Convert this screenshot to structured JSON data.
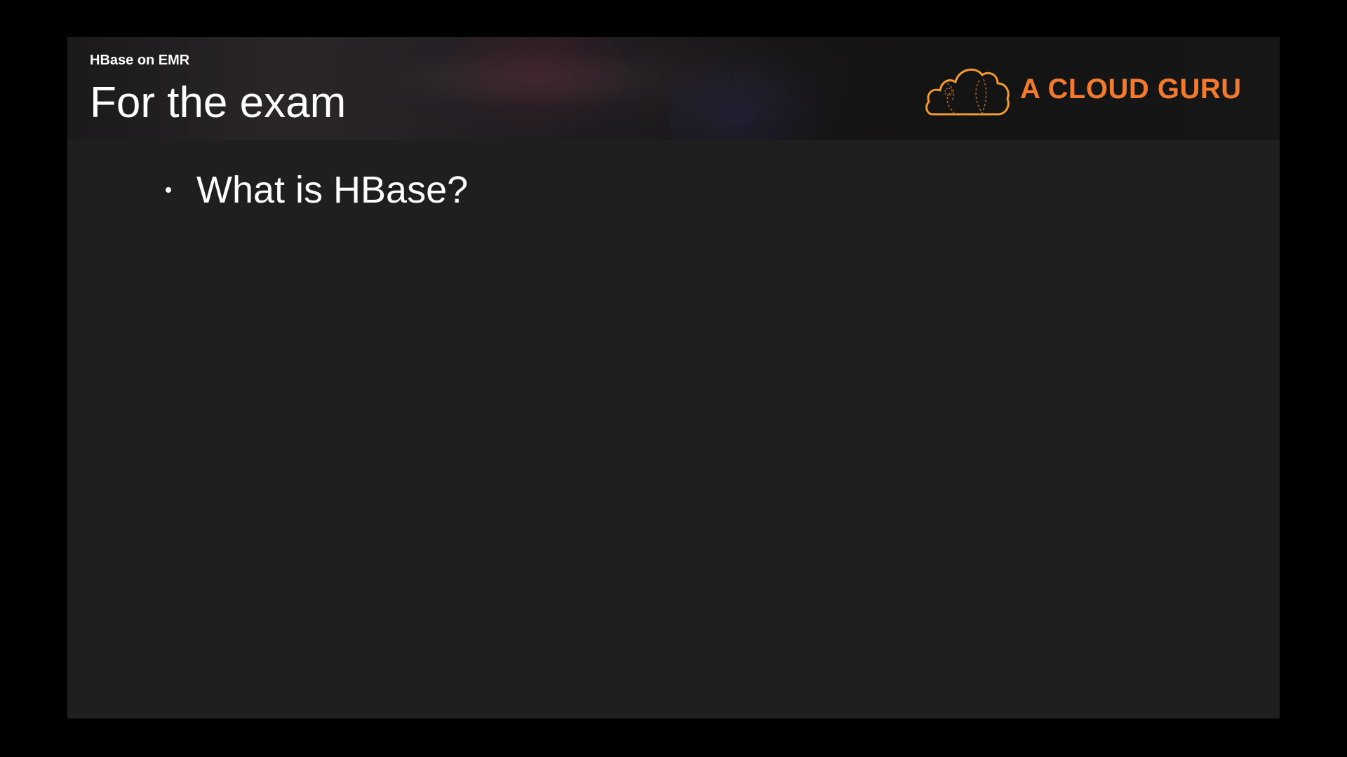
{
  "slide": {
    "subtitle": "HBase on EMR",
    "title": "For the exam",
    "bullets": [
      "What is HBase?"
    ]
  },
  "logo": {
    "text": "A CLOUD GURU",
    "icon": "cloud-logo-icon",
    "color": "#f27a2e"
  },
  "colors": {
    "background": "#000000",
    "slide_background": "#1f1f1f",
    "text": "#ffffff",
    "accent": "#f27a2e"
  }
}
